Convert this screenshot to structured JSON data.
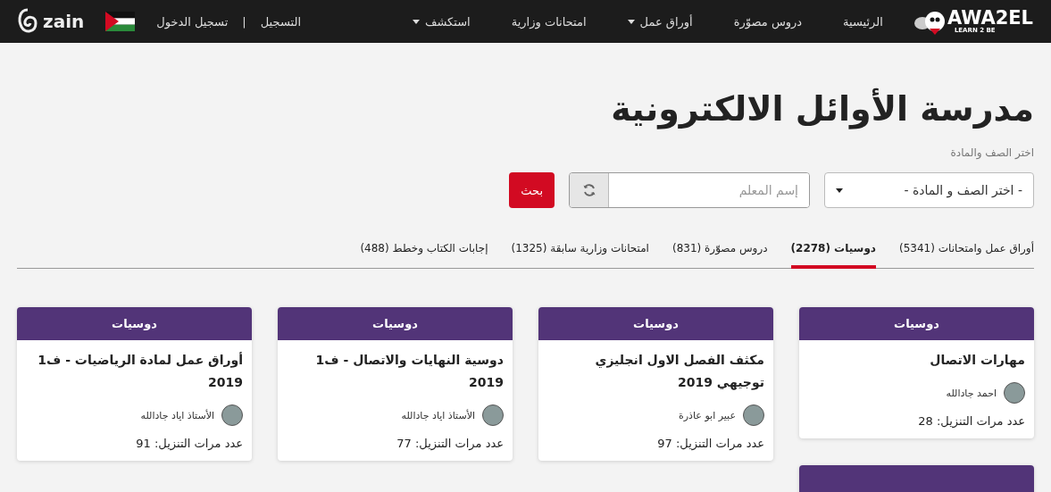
{
  "nav": {
    "logo": {
      "name": "AWA2EL",
      "tagline": "LEARN 2 BE"
    },
    "items": [
      {
        "label": "الرئيسية",
        "dropdown": false
      },
      {
        "label": "دروس مصوّرة",
        "dropdown": false
      },
      {
        "label": "أوراق عمل",
        "dropdown": true
      },
      {
        "label": "امتحانات وزارية",
        "dropdown": false
      },
      {
        "label": "استكشف",
        "dropdown": true
      }
    ],
    "register": "التسجيل",
    "separator": "|",
    "login": "تسجيل الدخول",
    "sponsor": "zain"
  },
  "title": "مدرسة الأوائل الالكترونية",
  "filter": {
    "label": "اختر الصف والمادة",
    "select": "- اختر الصف و المادة -",
    "teacher_placeholder": "إسم المعلم",
    "search_button": "بحث"
  },
  "tabs": [
    {
      "label": "أوراق عمل وامتحانات (5341)",
      "selected": false
    },
    {
      "label": "دوسيات (2278)",
      "selected": true
    },
    {
      "label": "دروس مصوّرة (831)",
      "selected": false
    },
    {
      "label": "امتحانات وزارية سابقة (1325)",
      "selected": false
    },
    {
      "label": "إجابات الكتاب وخطط (488)",
      "selected": false
    }
  ],
  "columns": [
    [
      {
        "kind": "full",
        "category": "دوسيات",
        "title": "مهارات الاتصال",
        "author": "احمد جادالله",
        "downloads": "عدد مرات التنزيل: 28"
      },
      {
        "kind": "cut"
      }
    ],
    [
      {
        "kind": "full",
        "category": "دوسيات",
        "title": "مكثف الفصل الاول انجليزي توجيهي 2019",
        "author": "عبير ابو عاذرة",
        "downloads": "عدد مرات التنزيل: 97"
      }
    ],
    [
      {
        "kind": "full",
        "category": "دوسيات",
        "title": "دوسية النهايات والاتصال - ف1 2019",
        "author": "الأستاذ اياد جادالله",
        "downloads": "عدد مرات التنزيل: 77"
      }
    ],
    [
      {
        "kind": "full",
        "category": "دوسيات",
        "title": "أوراق عمل لمادة الرياضيات - ف1 2019",
        "author": "الأستاذ اياد جادالله",
        "downloads": "عدد مرات التنزيل: 91"
      }
    ]
  ]
}
